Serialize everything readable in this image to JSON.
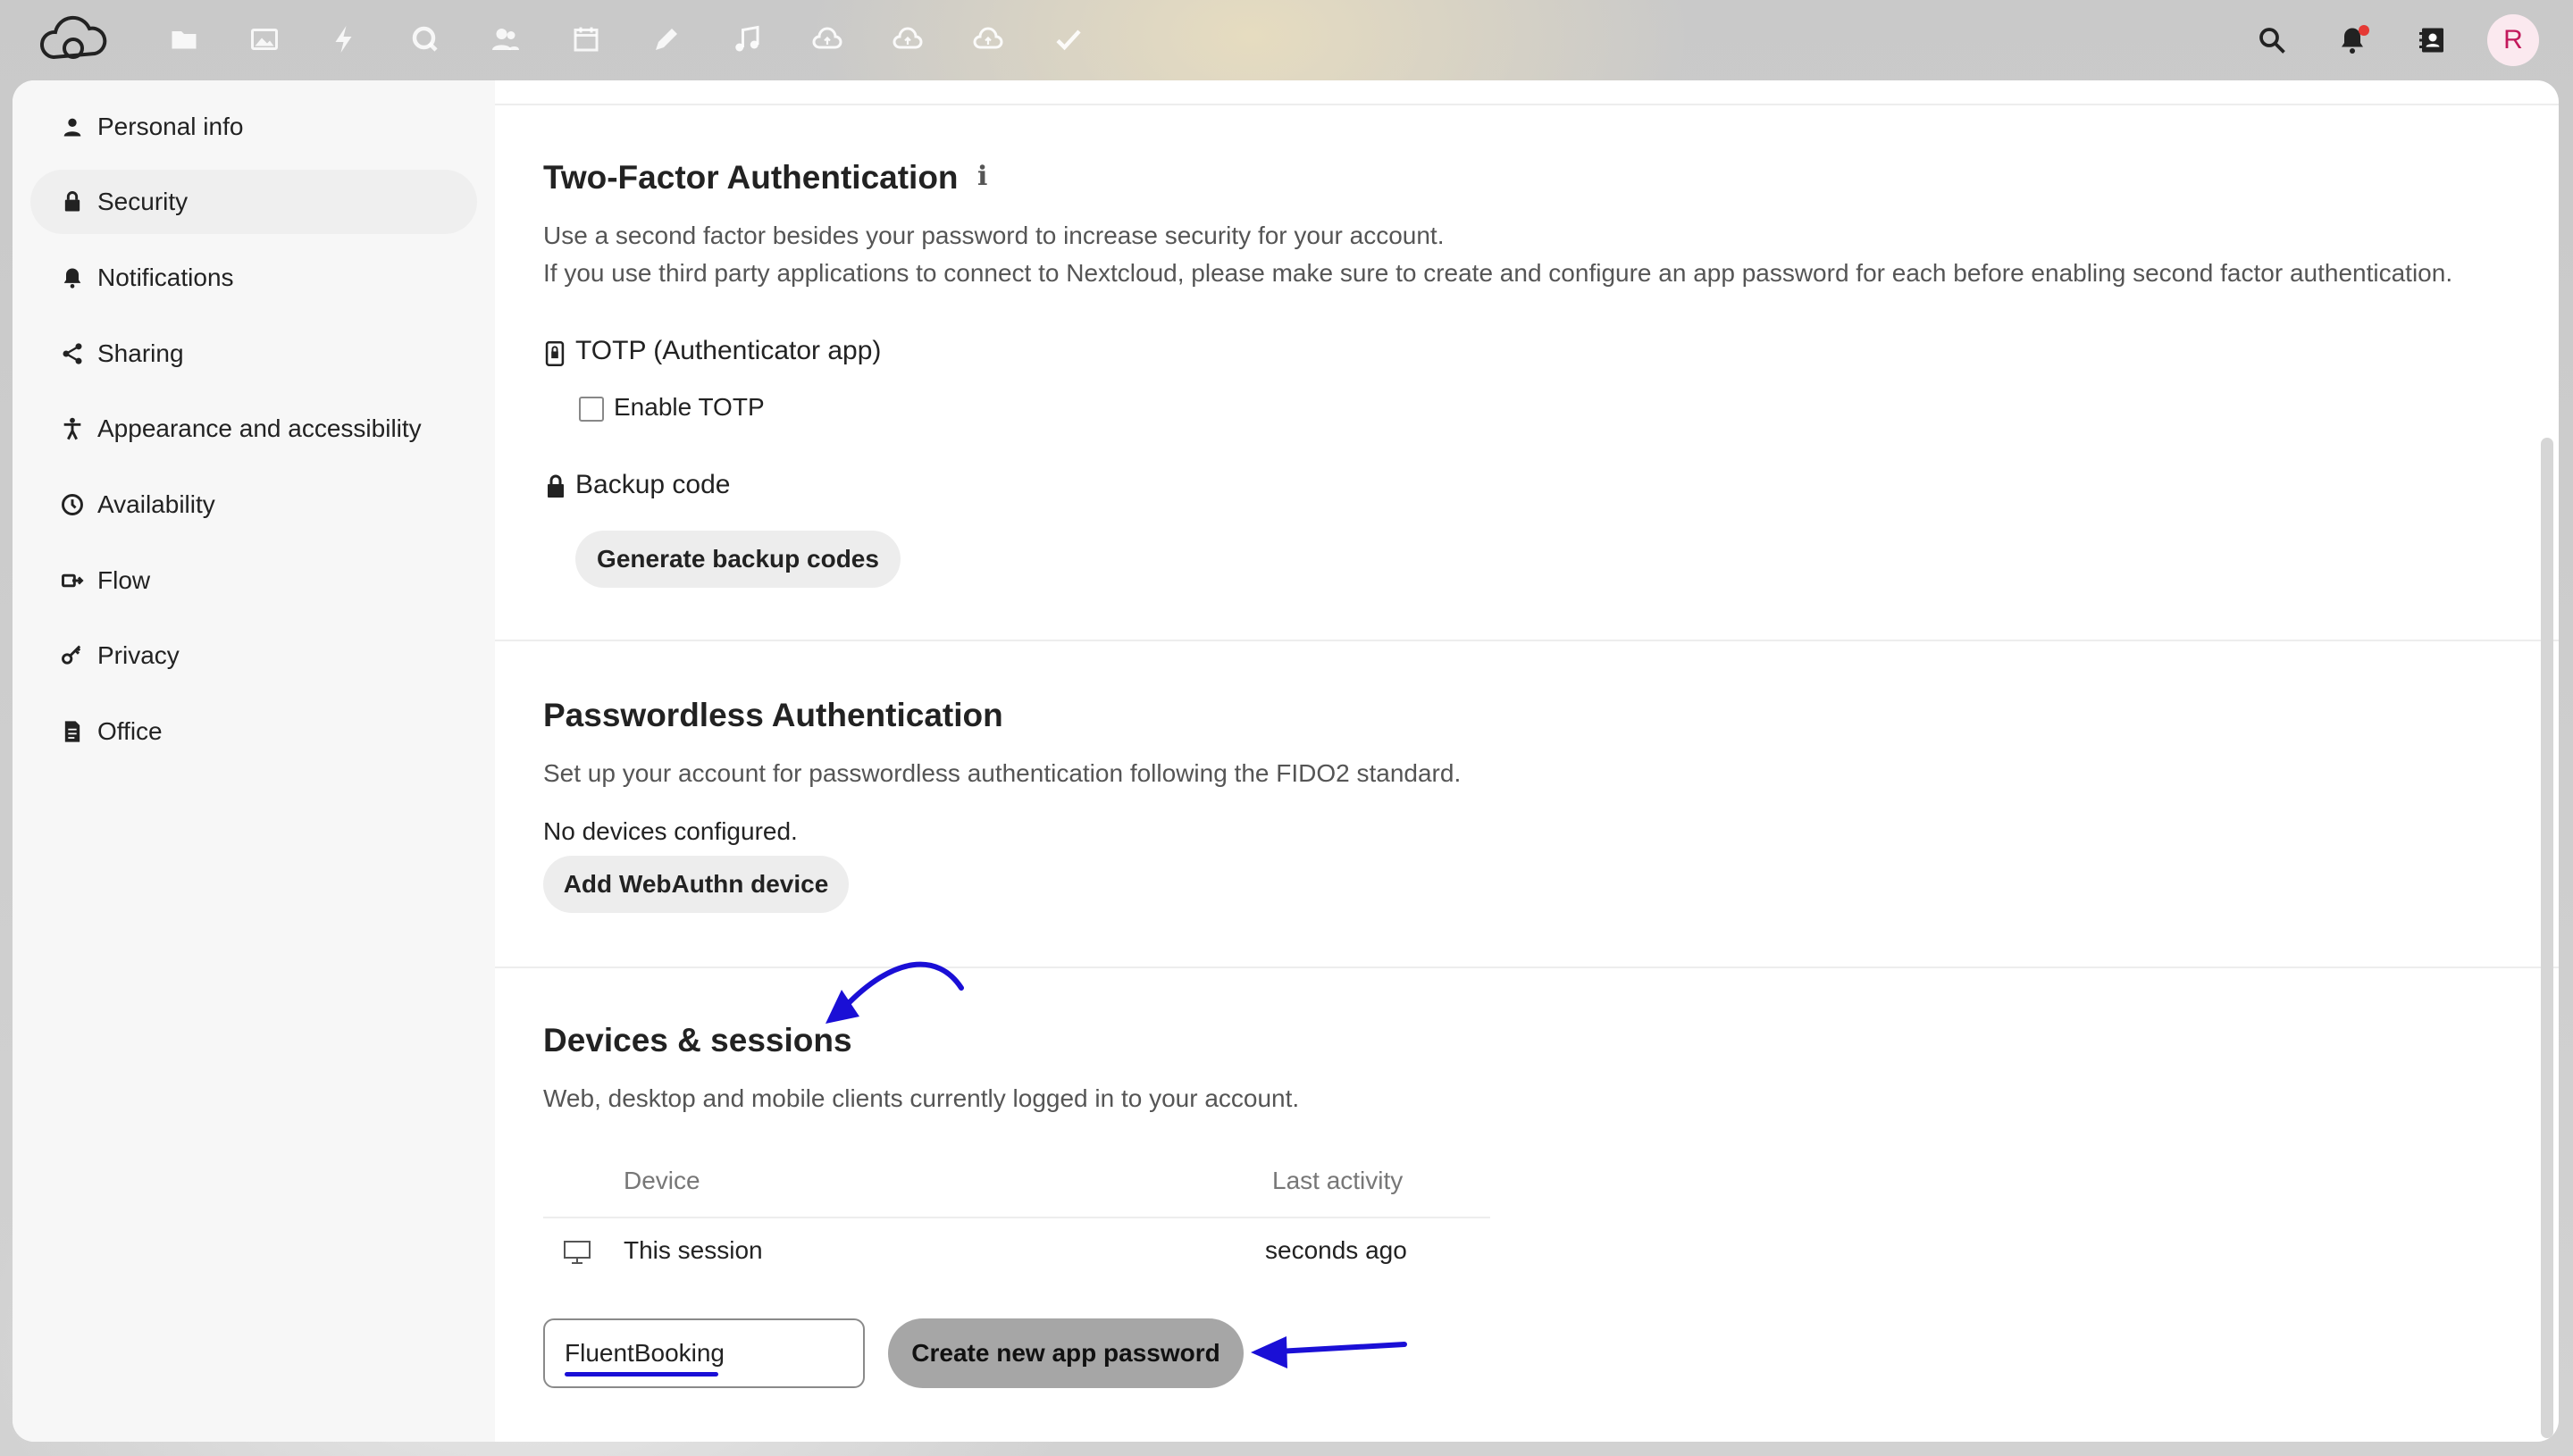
{
  "colors": {
    "accent_annotation": "#1a0fd6",
    "avatar_bg": "#fbe9ef",
    "avatar_text": "#c2185b",
    "primary_button": "#a6a6a6"
  },
  "topbar": {
    "apps": [
      "files-icon",
      "photos-icon",
      "activity-icon",
      "talk-icon",
      "contacts-icon",
      "calendar-icon",
      "notes-icon",
      "music-icon",
      "cloud-icon",
      "cloud-icon",
      "cloud-icon",
      "tasks-icon"
    ],
    "right": [
      "search-icon",
      "notifications-icon",
      "contacts-menu-icon"
    ],
    "avatar_letter": "R"
  },
  "sidebar": {
    "items": [
      {
        "label": "Personal info",
        "icon": "person-icon"
      },
      {
        "label": "Security",
        "icon": "lock-icon",
        "active": true
      },
      {
        "label": "Notifications",
        "icon": "bell-icon"
      },
      {
        "label": "Sharing",
        "icon": "share-icon"
      },
      {
        "label": "Appearance and accessibility",
        "icon": "accessibility-icon"
      },
      {
        "label": "Availability",
        "icon": "clock-icon"
      },
      {
        "label": "Flow",
        "icon": "flow-icon"
      },
      {
        "label": "Privacy",
        "icon": "key-icon"
      },
      {
        "label": "Office",
        "icon": "document-icon"
      }
    ]
  },
  "twofactor": {
    "title": "Two-Factor Authentication",
    "desc1": "Use a second factor besides your password to increase security for your account.",
    "desc2": "If you use third party applications to connect to Nextcloud, please make sure to create and configure an app password for each before enabling second factor authentication.",
    "totp_label": "TOTP (Authenticator app)",
    "enable_totp": "Enable TOTP",
    "backup_label": "Backup code",
    "generate_button": "Generate backup codes"
  },
  "passwordless": {
    "title": "Passwordless Authentication",
    "desc": "Set up your account for passwordless authentication following the FIDO2 standard.",
    "no_devices": "No devices configured.",
    "add_button": "Add WebAuthn device"
  },
  "sessions": {
    "title": "Devices & sessions",
    "desc": "Web, desktop and mobile clients currently logged in to your account.",
    "col_device": "Device",
    "col_activity": "Last activity",
    "rows": [
      {
        "device": "This session",
        "activity": "seconds ago"
      }
    ],
    "app_name_value": "FluentBooking",
    "create_button": "Create new app password"
  }
}
